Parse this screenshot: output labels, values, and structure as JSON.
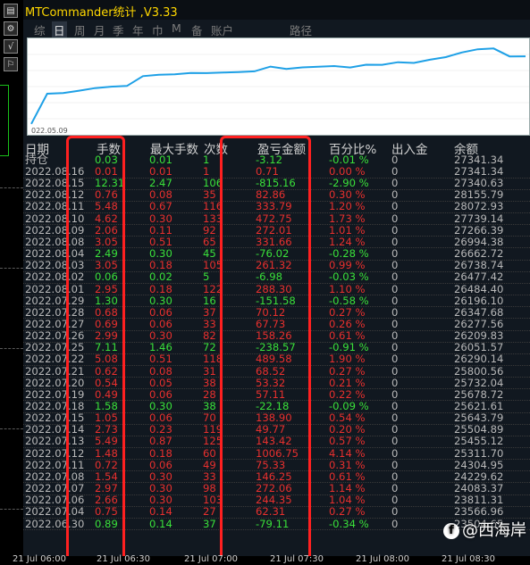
{
  "window": {
    "title": "MTCommander统计 ,V3.33"
  },
  "toolbar": {
    "buttons": [
      "▤",
      "⚙",
      "√",
      "⚐"
    ]
  },
  "menu": {
    "items": [
      "综",
      "日",
      "周",
      "月",
      "季",
      "年",
      "巾",
      "M",
      "备",
      "账户",
      "路径"
    ],
    "active_index": 1
  },
  "chart": {
    "start_label": "022.05.09",
    "line_color": "#1ea0e6"
  },
  "table": {
    "headers": [
      "日期",
      "手数",
      "最大手数",
      "次数",
      "盈亏金额",
      "百分比%",
      "出入金",
      "余额"
    ],
    "holding": {
      "label": "持仓",
      "lots": "0.03",
      "max": "0.01",
      "count": "1",
      "pnl": "-3.12",
      "pct": "-0.01 %",
      "io": "0",
      "balance": "27341.34",
      "pos": false
    },
    "rows": [
      {
        "date": "2022.08.16",
        "lots": "0.01",
        "max": "0.01",
        "count": "1",
        "pnl": "0.71",
        "pct": "0.00 %",
        "io": "0",
        "balance": "27341.34",
        "pos": true
      },
      {
        "date": "2022.08.15",
        "lots": "12.31",
        "max": "2.47",
        "count": "106",
        "pnl": "-815.16",
        "pct": "-2.90 %",
        "io": "0",
        "balance": "27340.63",
        "pos": false
      },
      {
        "date": "2022.08.12",
        "lots": "0.76",
        "max": "0.08",
        "count": "35",
        "pnl": "82.86",
        "pct": "0.30 %",
        "io": "0",
        "balance": "28155.79",
        "pos": true
      },
      {
        "date": "2022.08.11",
        "lots": "5.48",
        "max": "0.67",
        "count": "116",
        "pnl": "333.79",
        "pct": "1.20 %",
        "io": "0",
        "balance": "28072.93",
        "pos": true
      },
      {
        "date": "2022.08.10",
        "lots": "4.62",
        "max": "0.30",
        "count": "133",
        "pnl": "472.75",
        "pct": "1.73 %",
        "io": "0",
        "balance": "27739.14",
        "pos": true
      },
      {
        "date": "2022.08.09",
        "lots": "2.06",
        "max": "0.11",
        "count": "92",
        "pnl": "272.01",
        "pct": "1.01 %",
        "io": "0",
        "balance": "27266.39",
        "pos": true
      },
      {
        "date": "2022.08.08",
        "lots": "3.05",
        "max": "0.51",
        "count": "65",
        "pnl": "331.66",
        "pct": "1.24 %",
        "io": "0",
        "balance": "26994.38",
        "pos": true
      },
      {
        "date": "2022.08.04",
        "lots": "2.49",
        "max": "0.30",
        "count": "45",
        "pnl": "-76.02",
        "pct": "-0.28 %",
        "io": "0",
        "balance": "26662.72",
        "pos": false
      },
      {
        "date": "2022.08.03",
        "lots": "3.05",
        "max": "0.18",
        "count": "105",
        "pnl": "261.32",
        "pct": "0.99 %",
        "io": "0",
        "balance": "26738.74",
        "pos": true
      },
      {
        "date": "2022.08.02",
        "lots": "0.06",
        "max": "0.02",
        "count": "5",
        "pnl": "-6.98",
        "pct": "-0.03 %",
        "io": "0",
        "balance": "26477.42",
        "pos": false
      },
      {
        "date": "2022.08.01",
        "lots": "2.95",
        "max": "0.18",
        "count": "122",
        "pnl": "288.30",
        "pct": "1.10 %",
        "io": "0",
        "balance": "26484.40",
        "pos": true
      },
      {
        "date": "2022.07.29",
        "lots": "1.30",
        "max": "0.30",
        "count": "16",
        "pnl": "-151.58",
        "pct": "-0.58 %",
        "io": "0",
        "balance": "26196.10",
        "pos": false
      },
      {
        "date": "2022.07.28",
        "lots": "0.68",
        "max": "0.06",
        "count": "37",
        "pnl": "70.12",
        "pct": "0.27 %",
        "io": "0",
        "balance": "26347.68",
        "pos": true
      },
      {
        "date": "2022.07.27",
        "lots": "0.69",
        "max": "0.06",
        "count": "33",
        "pnl": "67.73",
        "pct": "0.26 %",
        "io": "0",
        "balance": "26277.56",
        "pos": true
      },
      {
        "date": "2022.07.26",
        "lots": "2.99",
        "max": "0.30",
        "count": "82",
        "pnl": "158.26",
        "pct": "0.61 %",
        "io": "0",
        "balance": "26209.83",
        "pos": true
      },
      {
        "date": "2022.07.25",
        "lots": "7.11",
        "max": "1.46",
        "count": "72",
        "pnl": "-238.57",
        "pct": "-0.91 %",
        "io": "0",
        "balance": "26051.57",
        "pos": false
      },
      {
        "date": "2022.07.22",
        "lots": "5.08",
        "max": "0.51",
        "count": "118",
        "pnl": "489.58",
        "pct": "1.90 %",
        "io": "0",
        "balance": "26290.14",
        "pos": true
      },
      {
        "date": "2022.07.21",
        "lots": "0.62",
        "max": "0.08",
        "count": "31",
        "pnl": "68.52",
        "pct": "0.27 %",
        "io": "0",
        "balance": "25800.56",
        "pos": true
      },
      {
        "date": "2022.07.20",
        "lots": "0.54",
        "max": "0.05",
        "count": "38",
        "pnl": "53.32",
        "pct": "0.21 %",
        "io": "0",
        "balance": "25732.04",
        "pos": true
      },
      {
        "date": "2022.07.19",
        "lots": "0.49",
        "max": "0.06",
        "count": "28",
        "pnl": "57.11",
        "pct": "0.22 %",
        "io": "0",
        "balance": "25678.72",
        "pos": true
      },
      {
        "date": "2022.07.18",
        "lots": "1.58",
        "max": "0.30",
        "count": "38",
        "pnl": "-22.18",
        "pct": "-0.09 %",
        "io": "0",
        "balance": "25621.61",
        "pos": false
      },
      {
        "date": "2022.07.15",
        "lots": "1.05",
        "max": "0.06",
        "count": "70",
        "pnl": "138.90",
        "pct": "0.54 %",
        "io": "0",
        "balance": "25643.79",
        "pos": true
      },
      {
        "date": "2022.07.14",
        "lots": "2.73",
        "max": "0.23",
        "count": "119",
        "pnl": "49.77",
        "pct": "0.20 %",
        "io": "0",
        "balance": "25504.89",
        "pos": true
      },
      {
        "date": "2022.07.13",
        "lots": "5.49",
        "max": "0.87",
        "count": "125",
        "pnl": "143.42",
        "pct": "0.57 %",
        "io": "0",
        "balance": "25455.12",
        "pos": true
      },
      {
        "date": "2022.07.12",
        "lots": "1.48",
        "max": "0.18",
        "count": "60",
        "pnl": "1006.75",
        "pct": "4.14 %",
        "io": "0",
        "balance": "25311.70",
        "pos": true
      },
      {
        "date": "2022.07.11",
        "lots": "0.72",
        "max": "0.06",
        "count": "49",
        "pnl": "75.33",
        "pct": "0.31 %",
        "io": "0",
        "balance": "24304.95",
        "pos": true
      },
      {
        "date": "2022.07.08",
        "lots": "1.54",
        "max": "0.30",
        "count": "33",
        "pnl": "146.25",
        "pct": "0.61 %",
        "io": "0",
        "balance": "24229.62",
        "pos": true
      },
      {
        "date": "2022.07.07",
        "lots": "2.97",
        "max": "0.30",
        "count": "98",
        "pnl": "272.06",
        "pct": "1.14 %",
        "io": "0",
        "balance": "24083.37",
        "pos": true
      },
      {
        "date": "2022.07.06",
        "lots": "2.66",
        "max": "0.30",
        "count": "103",
        "pnl": "244.35",
        "pct": "1.04 %",
        "io": "0",
        "balance": "23811.31",
        "pos": true
      },
      {
        "date": "2022.07.04",
        "lots": "0.75",
        "max": "0.14",
        "count": "27",
        "pnl": "62.31",
        "pct": "0.27 %",
        "io": "0",
        "balance": "23566.96",
        "pos": true
      },
      {
        "date": "2022.06.30",
        "lots": "0.89",
        "max": "0.14",
        "count": "37",
        "pnl": "-79.11",
        "pct": "-0.34 %",
        "io": "0",
        "balance": "23504.65",
        "pos": false
      }
    ]
  },
  "time_axis": {
    "labels": [
      "21 Jul 06:00",
      "21 Jul 06:30",
      "21 Jul 07:00",
      "21 Jul 07:30",
      "21 Jul 08:00",
      "21 Jul 08:30"
    ]
  },
  "watermark": {
    "icon": "f",
    "text": "@西海岸"
  },
  "colors": {
    "profit": "#e8302e",
    "loss": "#3ae03a",
    "title": "#ffd700",
    "highlight": "#ff2020"
  }
}
